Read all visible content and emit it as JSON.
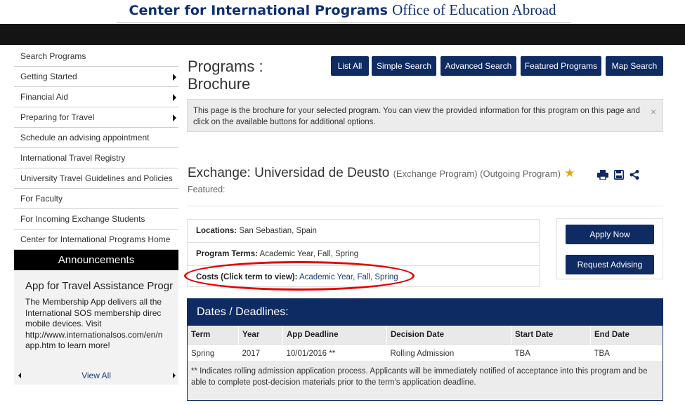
{
  "header": {
    "brand_strong": "Center for International Programs",
    "brand_light": "Office of Education Abroad"
  },
  "sidebar": {
    "items": [
      {
        "label": "Search Programs",
        "has_submenu": false
      },
      {
        "label": "Getting Started",
        "has_submenu": true
      },
      {
        "label": "Financial Aid",
        "has_submenu": true
      },
      {
        "label": "Preparing for Travel",
        "has_submenu": true
      },
      {
        "label": "Schedule an advising appointment",
        "has_submenu": false
      },
      {
        "label": "International Travel Registry",
        "has_submenu": false
      },
      {
        "label": "University Travel Guidelines and Policies",
        "has_submenu": false
      },
      {
        "label": "For Faculty",
        "has_submenu": false
      },
      {
        "label": "For Incoming Exchange Students",
        "has_submenu": false
      },
      {
        "label": "Center for International Programs Home",
        "has_submenu": false
      }
    ],
    "announcements": {
      "heading": "Announcements",
      "title": "App for Travel Assistance Progr",
      "body": "The Membership App delivers all the International SOS membership direc mobile devices. Visit http://www.internationalsos.com/en/n app.htm to learn more!",
      "view_all": "View All"
    }
  },
  "main": {
    "page_title": "Programs : Brochure",
    "nav_buttons": [
      "List All",
      "Simple Search",
      "Advanced Search",
      "Featured Programs",
      "Map Search"
    ],
    "notice": "This page is the brochure for your selected program. You can view the provided information for this program on this page and click on the available buttons for additional options.",
    "notice_close": "×",
    "program": {
      "name": "Exchange: Universidad de Deusto",
      "types": "(Exchange Program) (Outgoing Program)",
      "featured_label": "Featured:",
      "icons": [
        "print-icon",
        "save-icon",
        "share-icon"
      ]
    },
    "info": {
      "locations_label": "Locations:",
      "locations_value": "San Sebastian, Spain",
      "terms_label": "Program Terms:",
      "terms_value": "Academic Year, Fall, Spring",
      "costs_label": "Costs (Click term to view):",
      "costs_links": [
        "Academic Year",
        "Fall",
        "Spring"
      ]
    },
    "actions": {
      "apply": "Apply Now",
      "advising": "Request Advising"
    },
    "dates": {
      "heading": "Dates / Deadlines:",
      "columns": [
        "Term",
        "Year",
        "App Deadline",
        "Decision Date",
        "Start Date",
        "End Date"
      ],
      "rows": [
        [
          "Spring",
          "2017",
          "10/01/2016 **",
          "Rolling Admission",
          "TBA",
          "TBA"
        ]
      ],
      "footnote": "** Indicates rolling admission application process. Applicants will be immediately notified of acceptance into this program and be able to complete post-decision materials prior to the term's application deadline."
    }
  },
  "colors": {
    "navy": "#0f2b63",
    "highlight_ellipse": "#e60000",
    "star": "#e3a21a"
  }
}
